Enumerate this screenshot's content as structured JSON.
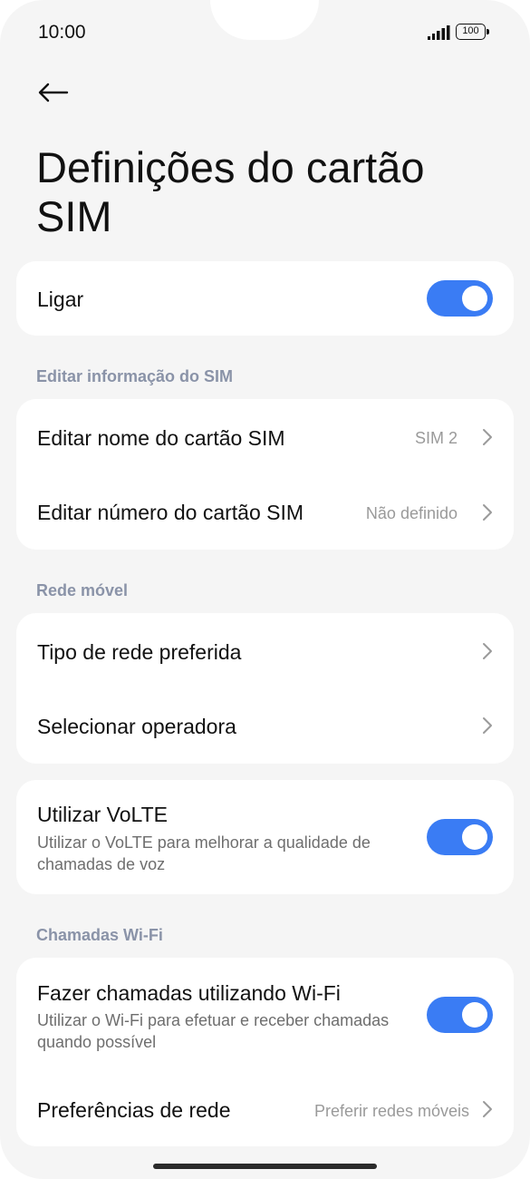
{
  "status_bar": {
    "time": "10:00",
    "battery": "100"
  },
  "header": {
    "title": "Definições do cartão SIM"
  },
  "power": {
    "label": "Ligar",
    "enabled": true
  },
  "sim_info": {
    "section_label": "Editar informação do SIM",
    "items": [
      {
        "label": "Editar nome do cartão SIM",
        "value": "SIM 2"
      },
      {
        "label": "Editar número do cartão SIM",
        "value": "Não definido"
      }
    ]
  },
  "mobile_network": {
    "section_label": "Rede móvel",
    "items": [
      {
        "label": "Tipo de rede preferida"
      },
      {
        "label": "Selecionar operadora"
      }
    ],
    "volte": {
      "label": "Utilizar VoLTE",
      "description": "Utilizar o VoLTE para melhorar a qualidade de chamadas de voz",
      "enabled": true
    }
  },
  "wifi_calling": {
    "section_label": "Chamadas Wi-Fi",
    "toggle": {
      "label": "Fazer chamadas utilizando Wi-Fi",
      "description": "Utilizar o Wi-Fi para efetuar e receber chamadas quando possível",
      "enabled": true
    },
    "preferences": {
      "label": "Preferências de rede",
      "value": "Preferir redes móveis"
    }
  },
  "colors": {
    "accent": "#3a7cf4",
    "background": "#f5f5f5",
    "card": "#ffffff",
    "section_header": "#8a93a8"
  },
  "icons": {
    "back": "arrow-left-icon",
    "chevron": "chevron-right-icon",
    "signal": "signal-icon",
    "battery": "battery-icon"
  }
}
